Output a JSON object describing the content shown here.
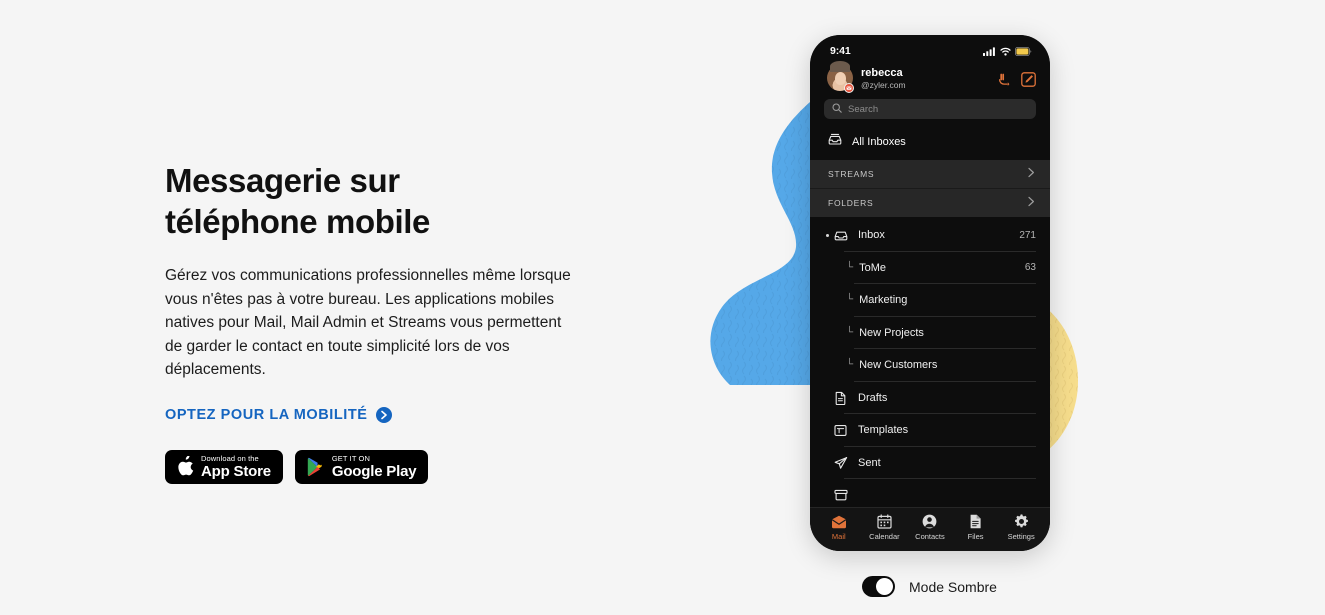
{
  "colors": {
    "page_background": "#f5f5f5",
    "blob_blue": "#55a8e8",
    "blob_yellow": "#f6dd8c",
    "link_blue": "#1565c0",
    "accent_orange": "#e0733a",
    "phone_background": "#0d0d0d",
    "section_background": "#272727"
  },
  "hero": {
    "title": "Messagerie sur téléphone mobile",
    "body": "Gérez vos communications professionnelles même lorsque vous n'êtes pas à votre bureau. Les applications mobiles natives pour Mail, Mail Admin et Streams vous permettent de garder le contact en toute simplicité lors de vos déplacements.",
    "cta_label": "OPTEZ POUR LA MOBILITÉ",
    "cta_icon": "arrow-right-circle-icon",
    "stores": [
      {
        "icon": "apple-logo-icon",
        "small_label": "Download on the",
        "big_label": "App Store"
      },
      {
        "icon": "google-play-logo-icon",
        "small_label": "GET IT ON",
        "big_label": "Google Play"
      }
    ]
  },
  "phone": {
    "status_bar": {
      "time": "9:41",
      "icons": [
        "cellular-signal-icon",
        "wifi-icon",
        "battery-icon"
      ]
    },
    "account": {
      "avatar_icon": "user-avatar",
      "avatar_badge_icon": "mail-badge-icon",
      "name": "rebecca",
      "handle": "@zyler.com",
      "actions": [
        {
          "icon": "do-not-disturb-icon"
        },
        {
          "icon": "compose-icon"
        }
      ]
    },
    "search": {
      "icon": "search-icon",
      "value": "",
      "placeholder": "Search"
    },
    "all_inboxes": {
      "icon": "all-inboxes-icon",
      "label": "All Inboxes"
    },
    "sections": [
      {
        "label": "STREAMS",
        "chevron": "chevron-right-icon"
      },
      {
        "label": "FOLDERS",
        "chevron": "chevron-right-icon"
      }
    ],
    "folders": [
      {
        "label": "Inbox",
        "count": "271",
        "icon": "inbox-icon",
        "child": false,
        "dot": true
      },
      {
        "label": "ToMe",
        "count": "63",
        "icon": "",
        "child": true,
        "dot": false
      },
      {
        "label": "Marketing",
        "count": "",
        "icon": "",
        "child": true,
        "dot": false
      },
      {
        "label": "New Projects",
        "count": "",
        "icon": "",
        "child": true,
        "dot": false
      },
      {
        "label": "New Customers",
        "count": "",
        "icon": "",
        "child": true,
        "dot": false
      },
      {
        "label": "Drafts",
        "count": "",
        "icon": "drafts-icon",
        "child": false,
        "dot": false
      },
      {
        "label": "Templates",
        "count": "",
        "icon": "templates-icon",
        "child": false,
        "dot": false
      },
      {
        "label": "Sent",
        "count": "",
        "icon": "sent-icon",
        "child": false,
        "dot": false
      },
      {
        "label": "",
        "count": "",
        "icon": "archive-icon",
        "child": false,
        "dot": false
      }
    ],
    "child_prefix": "└",
    "tabs": [
      {
        "label": "Mail",
        "icon": "mail-icon",
        "active": true
      },
      {
        "label": "Calendar",
        "icon": "calendar-icon",
        "active": false
      },
      {
        "label": "Contacts",
        "icon": "contacts-icon",
        "active": false
      },
      {
        "label": "Files",
        "icon": "files-icon",
        "active": false
      },
      {
        "label": "Settings",
        "icon": "settings-icon",
        "active": false
      }
    ]
  },
  "dark_mode": {
    "label": "Mode Sombre",
    "enabled": true
  }
}
